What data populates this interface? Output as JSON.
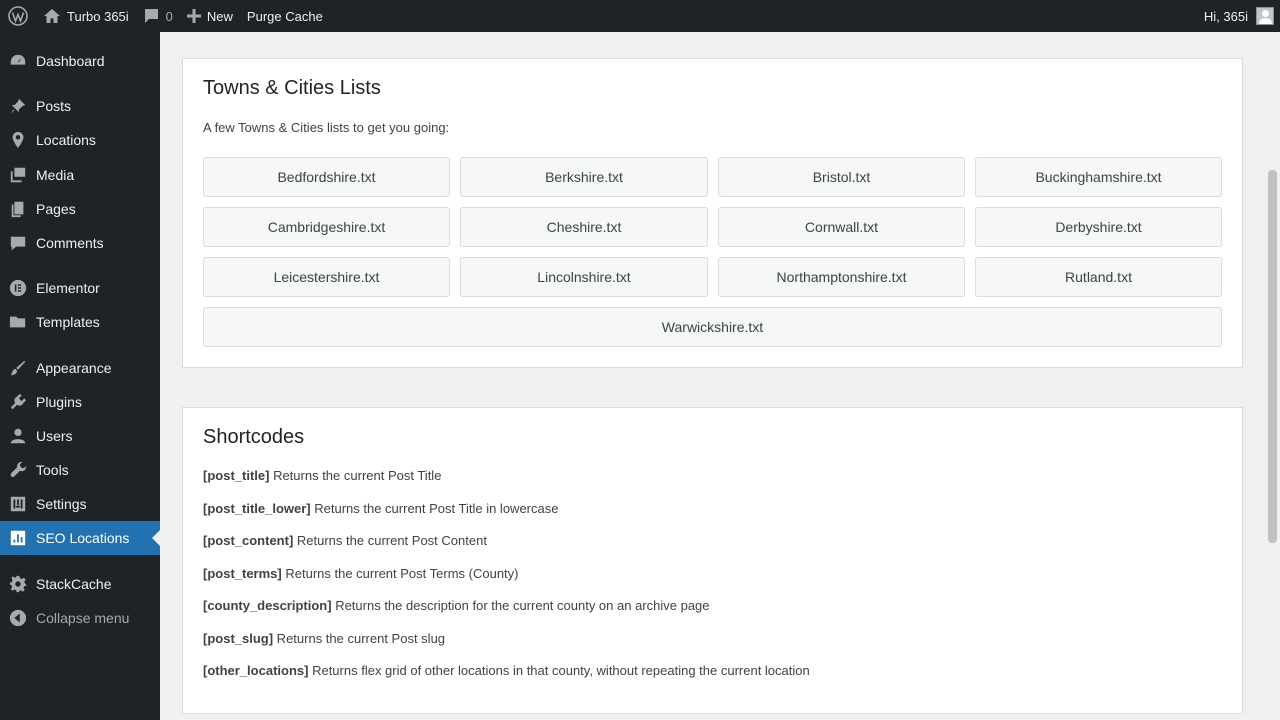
{
  "adminbar": {
    "site_name": "Turbo 365i",
    "comments_count": "0",
    "new_label": "New",
    "purge_label": "Purge Cache",
    "greeting": "Hi, 365i"
  },
  "sidebar": {
    "items": [
      {
        "label": "Dashboard",
        "icon": "dashboard-icon"
      },
      {
        "label": "Posts",
        "icon": "pin-icon"
      },
      {
        "label": "Locations",
        "icon": "location-icon"
      },
      {
        "label": "Media",
        "icon": "media-icon"
      },
      {
        "label": "Pages",
        "icon": "pages-icon"
      },
      {
        "label": "Comments",
        "icon": "comment-icon"
      },
      {
        "label": "Elementor",
        "icon": "elementor-icon"
      },
      {
        "label": "Templates",
        "icon": "folder-icon"
      },
      {
        "label": "Appearance",
        "icon": "brush-icon"
      },
      {
        "label": "Plugins",
        "icon": "plugin-icon"
      },
      {
        "label": "Users",
        "icon": "user-icon"
      },
      {
        "label": "Tools",
        "icon": "wrench-icon"
      },
      {
        "label": "Settings",
        "icon": "settings-icon"
      },
      {
        "label": "SEO Locations",
        "icon": "chart-icon",
        "active": true
      },
      {
        "label": "StackCache",
        "icon": "gear-icon"
      },
      {
        "label": "Collapse menu",
        "icon": "collapse-icon"
      }
    ],
    "active_color": "#2271b1"
  },
  "lists": {
    "title": "Towns & Cities Lists",
    "intro": "A few Towns & Cities lists to get you going:",
    "files": [
      "Bedfordshire.txt",
      "Berkshire.txt",
      "Bristol.txt",
      "Buckinghamshire.txt",
      "Cambridgeshire.txt",
      "Cheshire.txt",
      "Cornwall.txt",
      "Derbyshire.txt",
      "Leicestershire.txt",
      "Lincolnshire.txt",
      "Northamptonshire.txt",
      "Rutland.txt",
      "Warwickshire.txt"
    ]
  },
  "shortcodes": {
    "title": "Shortcodes",
    "items": [
      {
        "code": "[post_title]",
        "desc": " Returns the current Post Title"
      },
      {
        "code": "[post_title_lower]",
        "desc": " Returns the current Post Title in lowercase"
      },
      {
        "code": "[post_content]",
        "desc": " Returns the current Post Content"
      },
      {
        "code": "[post_terms]",
        "desc": " Returns the current Post Terms (County)"
      },
      {
        "code": "[county_description]",
        "desc": " Returns the description for the current county on an archive page"
      },
      {
        "code": "[post_slug]",
        "desc": " Returns the current Post slug"
      },
      {
        "code": "[other_locations]",
        "desc": " Returns flex grid of other locations in that county, without repeating the current location"
      }
    ]
  }
}
